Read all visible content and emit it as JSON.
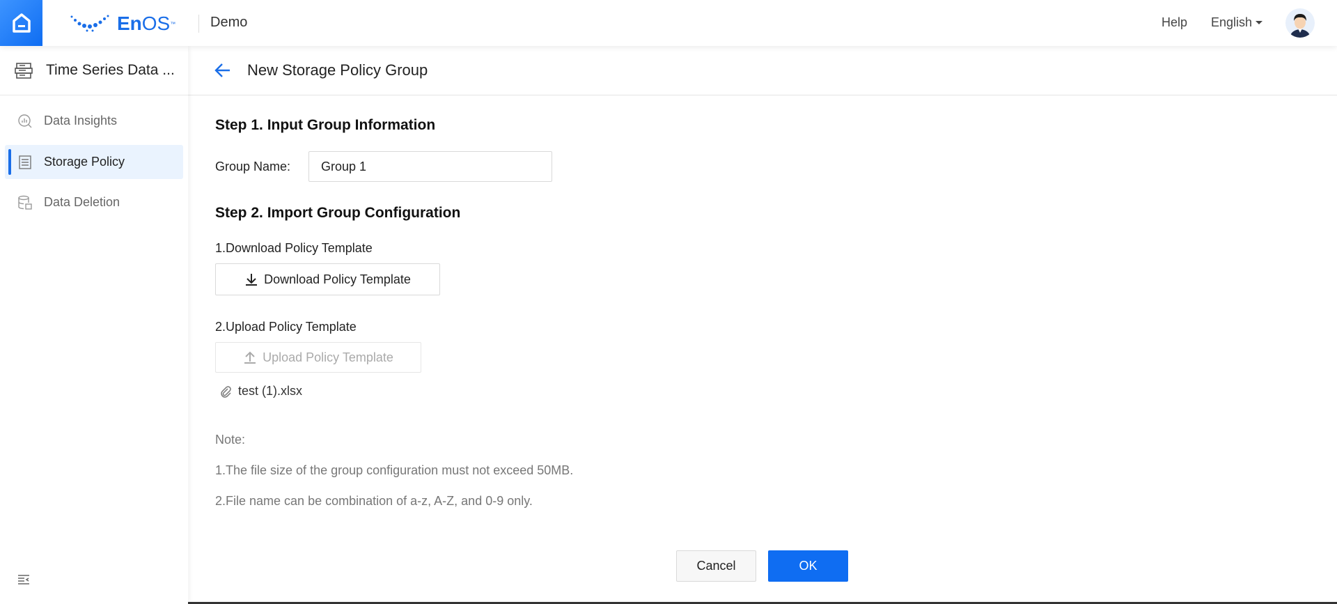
{
  "header": {
    "app_name": "Demo",
    "logo_text_bold": "En",
    "logo_text": "OS",
    "logo_tm": "™",
    "help": "Help",
    "language": "English"
  },
  "sidebar": {
    "title": "Time Series Data ...",
    "items": [
      {
        "label": "Data Insights",
        "active": false
      },
      {
        "label": "Storage Policy",
        "active": true
      },
      {
        "label": "Data Deletion",
        "active": false
      }
    ]
  },
  "page": {
    "title": "New Storage Policy Group"
  },
  "step1": {
    "heading": "Step 1. Input Group Information",
    "group_name_label": "Group Name:",
    "group_name_value": "Group 1"
  },
  "step2": {
    "heading": "Step 2. Import Group Configuration",
    "download_label": "1.Download Policy Template",
    "download_button": "Download Policy Template",
    "upload_label": "2.Upload Policy Template",
    "upload_button": "Upload Policy Template",
    "file_name": "test (1).xlsx"
  },
  "notes": {
    "title": "Note:",
    "line1": "1.The file size of the group configuration must not exceed 50MB.",
    "line2": "2.File name can be combination of a-z, A-Z, and 0-9 only."
  },
  "footer": {
    "cancel": "Cancel",
    "ok": "OK"
  },
  "colors": {
    "primary": "#0f6df2",
    "active_bg": "#eaf3fe"
  }
}
